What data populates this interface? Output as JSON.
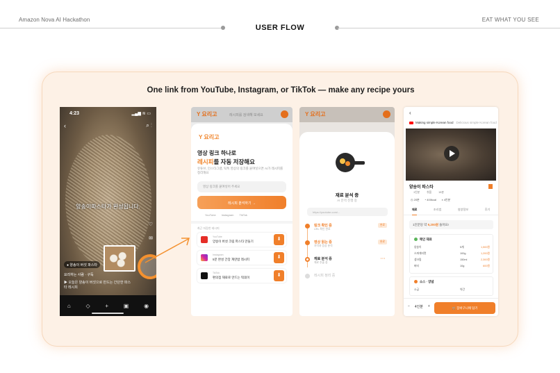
{
  "header": {
    "left_label": "Amazon Nova AI Hackathon",
    "center_title": "USER FLOW",
    "right_label": "EAT WHAT YOU SEE"
  },
  "card": {
    "title": "One link from YouTube, Instagram, or TikTok — make any recipe yours"
  },
  "screen_video": {
    "status_time": "4:23",
    "status_right": "▂▄▆ ≋ ▭",
    "subtitle": "양송이파스타가 완성됩니다.",
    "chip": "● 양송이 버섯 파스타",
    "user": "요리하는 사람 · 구독",
    "description": "▶ 오늘은 양송이 버섯으로 만드는 간단한 파스타 레시피",
    "nav_icons": [
      "⌂",
      "◇",
      "+",
      "▣",
      "◉"
    ]
  },
  "screen_input": {
    "logo": "Y 요리고",
    "top_search": "레시피를 검색해 보세요",
    "heading_line1": "영상 링크 하나로",
    "heading_highlight": "레시피",
    "heading_line2_rest": "를 자동 저장해요",
    "helper": "유튜브, 인스타그램, 틱톡 영상의 링크를 붙여넣으면 AI가 레시피를 정리해요",
    "input_placeholder": "영상 링크를 붙여넣어 주세요",
    "cta": "레시피 분석하기 →",
    "sources": [
      "YouTube",
      "Instagram",
      "TikTok"
    ],
    "recent_label": "최근 저장한 레시피",
    "items": [
      {
        "source": "YouTube",
        "title": "양송이 버섯 크림 파스타 만들기",
        "color": "#e52d27"
      },
      {
        "source": "Instagram",
        "title": "5분 완성 간장 계란밥 레시피",
        "color": "#d6249f"
      },
      {
        "source": "TikTok",
        "title": "편의점 재료로 만드는 떡볶이",
        "color": "#111111"
      }
    ],
    "download_icon": "⬇"
  },
  "screen_analyze": {
    "title": "재료 분석 중",
    "subtitle": "AI 분석 진행 중",
    "url": "https://youtube.com/...",
    "steps": [
      {
        "label": "링크 확인 중",
        "detail": "URL 확인 완료",
        "tag": "완료",
        "state": "done"
      },
      {
        "label": "영상 읽는 중",
        "detail": "자막과 음성 분석",
        "tag": "완료",
        "state": "done"
      },
      {
        "label": "재료 분석 중",
        "detail": "재료 추출 중",
        "tag": "• • •",
        "state": "active"
      },
      {
        "label": "레시피 정리 중",
        "detail": "",
        "tag": "",
        "state": "pending"
      }
    ]
  },
  "screen_recipe": {
    "back": "‹",
    "channel": "Making simple Korean food",
    "channel_sub": "Delicious simple Korean food",
    "title": "양송이 파스타",
    "meta": [
      "1인분",
      "쉬움",
      "15분"
    ],
    "stats": [
      "◷ 20분",
      "◔ 400kcal",
      "◑ 4인분"
    ],
    "tabs": [
      "재료",
      "조리법",
      "영양정보",
      "후기"
    ],
    "active_tab": "재료",
    "note_prefix": "1인분당 약 ",
    "note_highlight": "9,200원",
    "note_suffix": " 들어요!",
    "group1_title": "메인 재료",
    "group1_items": [
      {
        "name": "양송이",
        "qty": "5개",
        "price": "1,500원"
      },
      {
        "name": "스파게티면",
        "qty": "100g",
        "price": "1,200원"
      },
      {
        "name": "생크림",
        "qty": "150ml",
        "price": "2,300원"
      },
      {
        "name": "버터",
        "qty": "10g",
        "price": "600원"
      }
    ],
    "group2_title": "소스 · 양념",
    "group2_items": [
      {
        "name": "소금",
        "qty": "약간",
        "price": ""
      }
    ],
    "qty_minus": "−",
    "qty_value": "4인분",
    "qty_plus": "+",
    "cta": "🛒 장바구니에 담기"
  }
}
